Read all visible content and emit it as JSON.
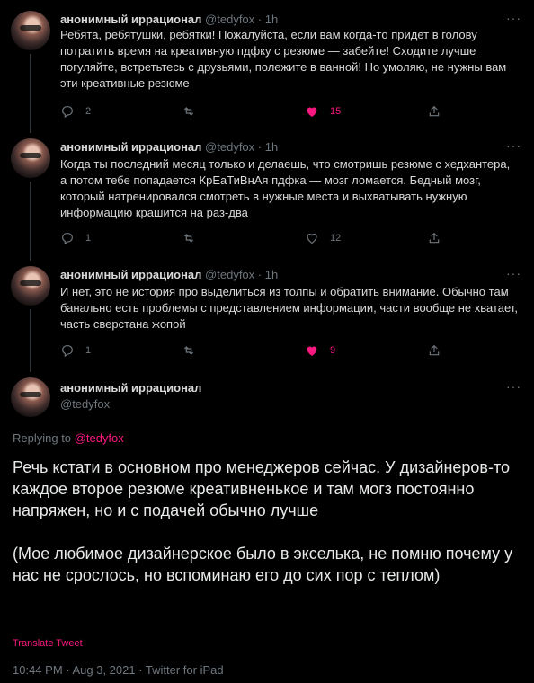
{
  "tweets": [
    {
      "name": "анонимный иррационал",
      "handle": "@tedyfox",
      "dot": "·",
      "time": "1h",
      "more": "···",
      "text": "Ребята, ребятушки, ребятки! Пожалуйста, если вам когда-то придет в голову потратить время на креативную пдфку с резюме — забейте! Сходите лучше погуляйте, встретьтесь с друзьями, полежите в ванной! Но умоляю, не нужны вам эти креативные резюме",
      "replies": "2",
      "retweets": "",
      "likes": "15",
      "liked": true
    },
    {
      "name": "анонимный иррационал",
      "handle": "@tedyfox",
      "dot": "·",
      "time": "1h",
      "more": "···",
      "text": "Когда ты последний месяц только и делаешь, что смотришь резюме с хедхантера, а потом тебе попадается КрЕаТиВнАя пдфка — мозг ломается. Бедный мозг, который натренировался смотреть в нужные места и выхватывать нужную информацию крашится на раз-два",
      "replies": "1",
      "retweets": "",
      "likes": "12",
      "liked": false
    },
    {
      "name": "анонимный иррационал",
      "handle": "@tedyfox",
      "dot": "·",
      "time": "1h",
      "more": "···",
      "text": "И нет, это не история про выделиться из толпы и обратить внимание. Обычно там банально есть проблемы с представлением информации, части вообще не хватает, часть сверстана жопой",
      "replies": "1",
      "retweets": "",
      "likes": "9",
      "liked": true
    }
  ],
  "main": {
    "name": "анонимный иррационал",
    "handle": "@tedyfox",
    "more": "···",
    "replying_prefix": "Replying to ",
    "replying_to": "@tedyfox",
    "text": "Речь кстати в основном про менеджеров сейчас. У дизайнеров-то каждое второе резюме креативненькое и там могз постоянно напряжен, но и с подачей обычно лучше\n\n(Мое любимое дизайнерское было в экселька, не помню почему у нас не срослось, но вспоминаю его до сих пор с теплом)",
    "translate": "Translate Tweet",
    "meta": "10:44 PM · Aug 3, 2021 · Twitter for iPad"
  },
  "colors": {
    "accent": "#f91880",
    "muted": "#6e767d",
    "bg": "#000000"
  },
  "icons": [
    "reply-icon",
    "retweet-icon",
    "like-icon",
    "share-icon",
    "more-icon"
  ]
}
